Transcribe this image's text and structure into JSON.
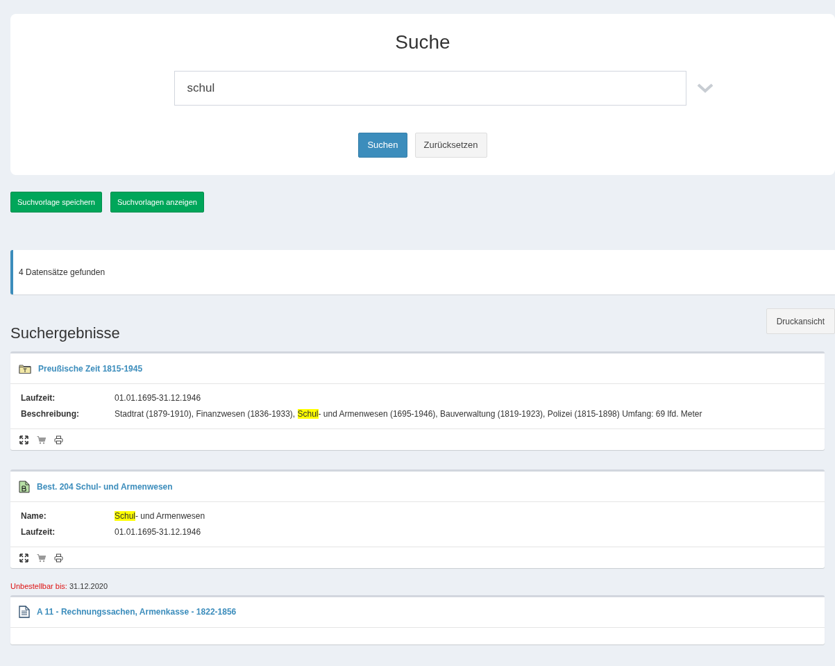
{
  "search": {
    "title": "Suche",
    "value": "schul",
    "buttons": [
      {
        "label": "Suchen",
        "kind": "primary"
      },
      {
        "label": "Zurücksetzen",
        "kind": "default"
      }
    ]
  },
  "template_buttons": [
    "Suchvorlage speichern",
    "Suchvorlagen anzeigen"
  ],
  "result_count": "4 Datensätze gefunden",
  "results_heading": "Suchergebnisse",
  "print_button": "Druckansicht",
  "results": [
    {
      "kind": "folder",
      "title": "Preußische Zeit 1815-1945",
      "fields": [
        {
          "label": "Laufzeit:",
          "value": [
            {
              "text": "01.01.1695-31.12.1946",
              "highlighted": false
            }
          ]
        },
        {
          "label": "Beschreibung:",
          "value": [
            {
              "text": "Stadtrat (1879-1910), Finanzwesen (1836-1933), ",
              "highlighted": false
            },
            {
              "text": "Schul",
              "highlighted": true
            },
            {
              "text": "- und Armenwesen (1695-1946), Bauverwaltung (1819-1923), Polizei (1815-1898) Umfang: 69 lfd. Meter",
              "highlighted": false
            }
          ]
        }
      ],
      "actions": true
    },
    {
      "kind": "document-b",
      "title": "Best. 204 Schul- und Armenwesen",
      "fields": [
        {
          "label": "Name:",
          "value": [
            {
              "text": "Schul",
              "highlighted": true
            },
            {
              "text": "- und Armenwesen",
              "highlighted": false
            }
          ]
        },
        {
          "label": "Laufzeit:",
          "value": [
            {
              "text": "01.01.1695-31.12.1946",
              "highlighted": false
            }
          ]
        }
      ],
      "actions": true
    },
    {
      "notice": {
        "label": "Unbestellbar bis:",
        "value": "31.12.2020"
      },
      "kind": "document",
      "title": "A 11 - Rechnungssachen, Armenkasse - 1822-1856",
      "actions": false
    }
  ]
}
